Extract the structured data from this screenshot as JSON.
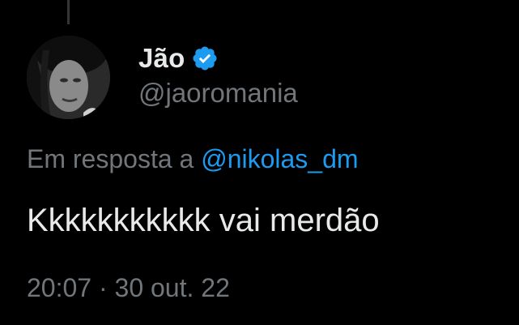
{
  "colors": {
    "background": "#000000",
    "primary_text": "#e7e9ea",
    "secondary_text": "#71767b",
    "accent": "#1d9bf0"
  },
  "author": {
    "display_name": "Jão",
    "handle": "@jaoromania",
    "verified": true
  },
  "reply": {
    "prefix": "Em resposta a",
    "mention": "@nikolas_dm"
  },
  "tweet": {
    "text": "Kkkkkkkkkkk vai merdão"
  },
  "meta": {
    "time": "20:07",
    "separator": "·",
    "date": "30 out. 22"
  },
  "icons": {
    "verified": "verified-badge-icon"
  }
}
